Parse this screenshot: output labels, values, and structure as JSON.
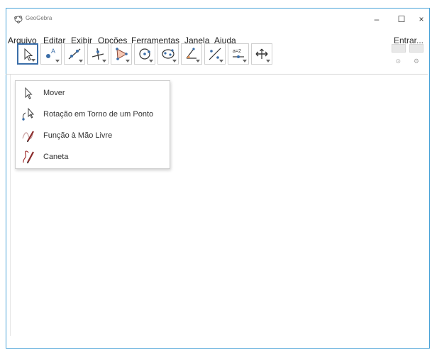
{
  "window": {
    "title": "GeoGebra"
  },
  "controls": {
    "minimize": "–",
    "maximize": "☐",
    "close": "×"
  },
  "menubar": {
    "items": [
      "Arquivo",
      "Editar",
      "Exibir",
      "Opções",
      "Ferramentas",
      "Janela",
      "Ajuda"
    ],
    "login": "Entrar..."
  },
  "toolbar": {
    "tools": [
      "move-tool-icon",
      "point-tool-icon",
      "line-tool-icon",
      "perpendicular-tool-icon",
      "polygon-tool-icon",
      "circle-tool-icon",
      "conic-tool-icon",
      "angle-tool-icon",
      "reflect-tool-icon",
      "slider-tool-icon",
      "move-view-tool-icon"
    ]
  },
  "dropdown": {
    "items": [
      {
        "label": "Mover",
        "icon": "move-arrow-icon"
      },
      {
        "label": "Rotação em Torno de um Ponto",
        "icon": "rotate-around-point-icon"
      },
      {
        "label": "Função à Mão Livre",
        "icon": "freehand-function-icon"
      },
      {
        "label": "Caneta",
        "icon": "pen-icon"
      }
    ]
  },
  "colors": {
    "accent": "#3b6ea8",
    "border": "#4aa3d8"
  }
}
